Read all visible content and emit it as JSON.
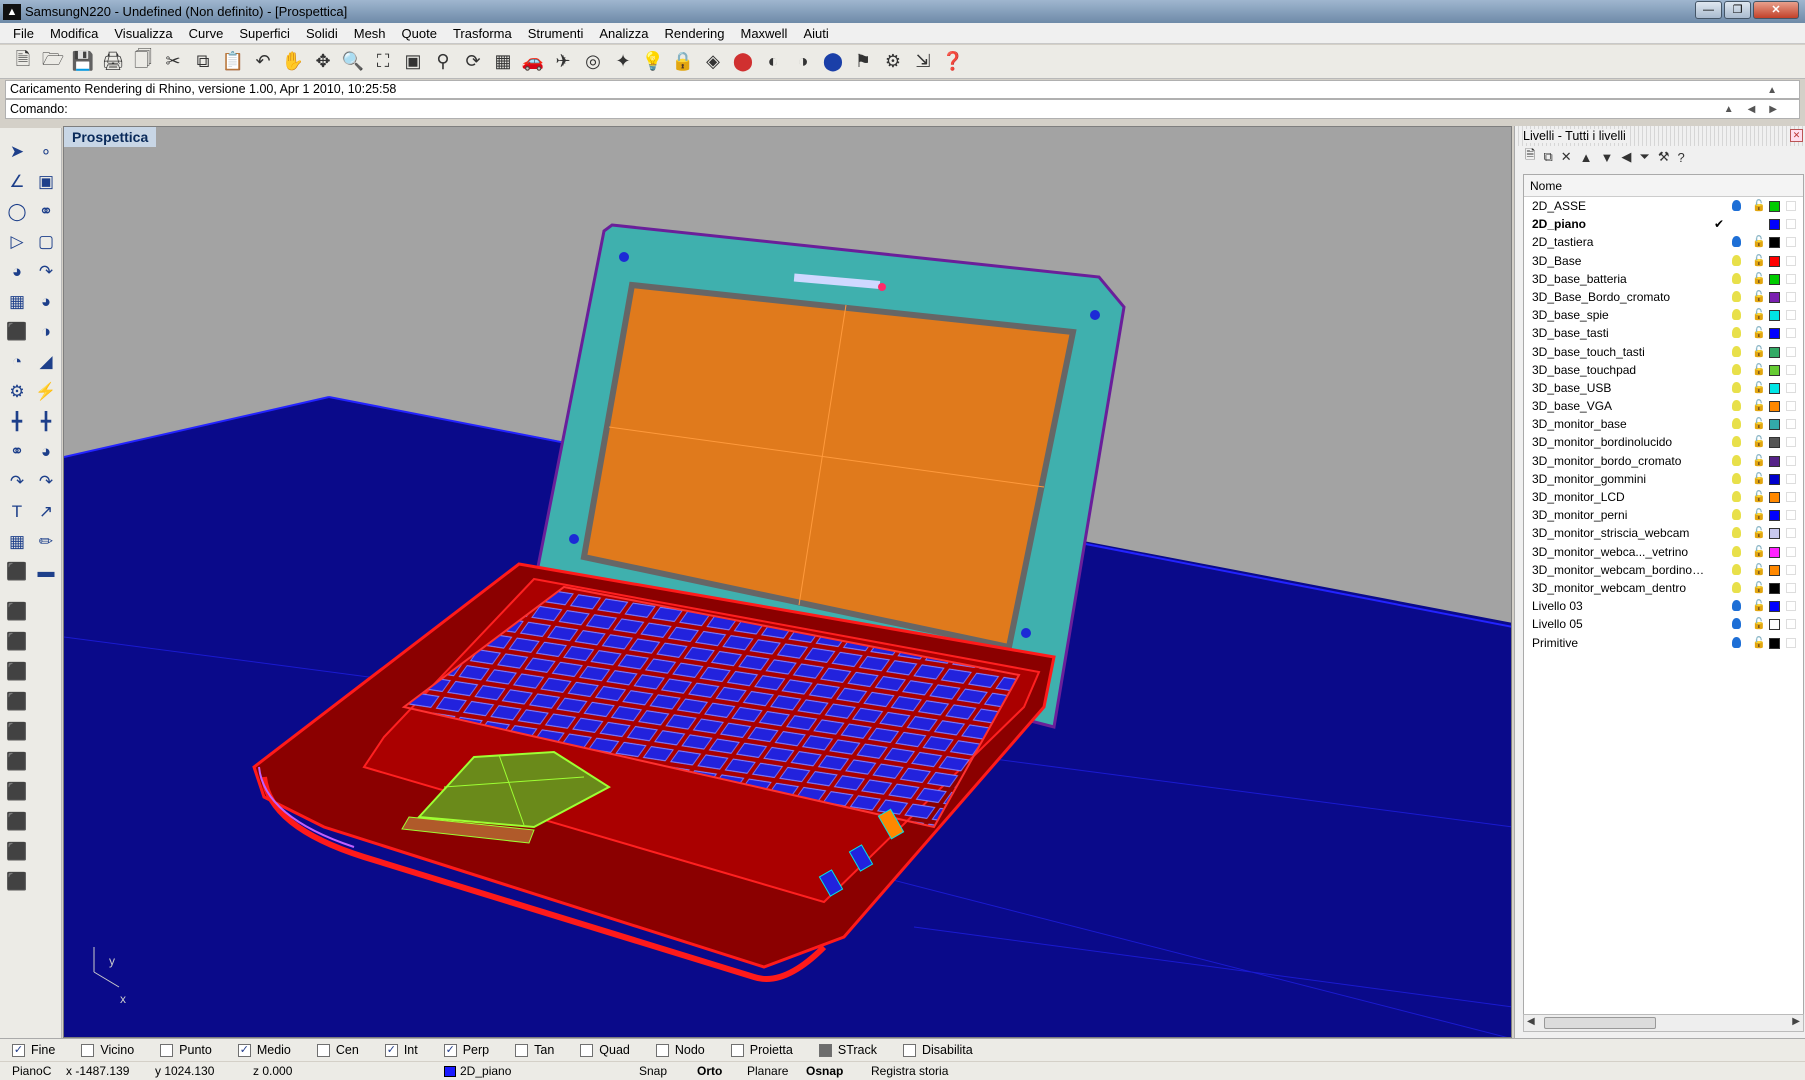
{
  "window": {
    "title": "SamsungN220 - Undefined (Non definito) - [Prospettica]",
    "app_icon": "rhino-icon",
    "controls": [
      "minimize",
      "maximize",
      "close"
    ]
  },
  "menu": [
    "File",
    "Modifica",
    "Visualizza",
    "Curve",
    "Superfici",
    "Solidi",
    "Mesh",
    "Quote",
    "Trasforma",
    "Strumenti",
    "Analizza",
    "Rendering",
    "Maxwell",
    "Aiuti"
  ],
  "toolbar_icons": [
    "new-icon",
    "open-icon",
    "save-icon",
    "print-icon",
    "import-icon",
    "cut-icon",
    "copy-icon",
    "paste-icon",
    "undo-icon",
    "pan-icon",
    "rotate-view-icon",
    "zoom-icon",
    "zoom-window-icon",
    "zoom-extents-icon",
    "zoom-selected-icon",
    "rotate-icon",
    "grid-icon",
    "car-icon",
    "plane-icon",
    "target-icon",
    "osnap-icon",
    "light-icon",
    "lock-icon",
    "render-icon",
    "color-wheel-icon",
    "shade-icon",
    "wire-icon",
    "render-sphere-icon",
    "flag-icon",
    "gear-icon",
    "dimension-icon",
    "help-icon"
  ],
  "command": {
    "history": "Caricamento Rendering di Rhino, versione 1.00, Apr  1 2010, 10:25:58",
    "prompt": "Comando:",
    "input": ""
  },
  "viewport": {
    "label": "Prospettica",
    "axis_x": "x",
    "axis_y": "y"
  },
  "layers_panel": {
    "title": "Livelli - Tutti i livelli",
    "column_header": "Nome",
    "tool_icons": [
      "new-layer-icon",
      "new-sublayer-icon",
      "delete-icon",
      "move-up-icon",
      "move-down-icon",
      "move-left-icon",
      "filter-icon",
      "tools-icon",
      "help-icon"
    ],
    "layers": [
      {
        "name": "2D_ASSE",
        "color": "#00cc00",
        "current": false,
        "bulb": "#1e6fd6"
      },
      {
        "name": "2D_piano",
        "color": "#0000ff",
        "current": true,
        "bulb": ""
      },
      {
        "name": "2D_tastiera",
        "color": "#000000",
        "current": false,
        "bulb": "#1e6fd6"
      },
      {
        "name": "3D_Base",
        "color": "#ff0000",
        "current": false,
        "bulb": "#e8e04a"
      },
      {
        "name": "3D_base_batteria",
        "color": "#00cc00",
        "current": false,
        "bulb": "#e8e04a"
      },
      {
        "name": "3D_Base_Bordo_cromato",
        "color": "#7a1fb0",
        "current": false,
        "bulb": "#e8e04a"
      },
      {
        "name": "3D_base_spie",
        "color": "#00e5e5",
        "current": false,
        "bulb": "#e8e04a"
      },
      {
        "name": "3D_base_tasti",
        "color": "#0000ff",
        "current": false,
        "bulb": "#e8e04a"
      },
      {
        "name": "3D_base_touch_tasti",
        "color": "#33aa66",
        "current": false,
        "bulb": "#e8e04a"
      },
      {
        "name": "3D_base_touchpad",
        "color": "#66cc33",
        "current": false,
        "bulb": "#e8e04a"
      },
      {
        "name": "3D_base_USB",
        "color": "#00e5e5",
        "current": false,
        "bulb": "#e8e04a"
      },
      {
        "name": "3D_base_VGA",
        "color": "#ff8800",
        "current": false,
        "bulb": "#e8e04a"
      },
      {
        "name": "3D_monitor_base",
        "color": "#33aaaa",
        "current": false,
        "bulb": "#e8e04a"
      },
      {
        "name": "3D_monitor_bordinolucido",
        "color": "#555555",
        "current": false,
        "bulb": "#e8e04a"
      },
      {
        "name": "3D_monitor_bordo_cromato",
        "color": "#552288",
        "current": false,
        "bulb": "#e8e04a"
      },
      {
        "name": "3D_monitor_gommini",
        "color": "#0000cc",
        "current": false,
        "bulb": "#e8e04a"
      },
      {
        "name": "3D_monitor_LCD",
        "color": "#ff8800",
        "current": false,
        "bulb": "#e8e04a"
      },
      {
        "name": "3D_monitor_perni",
        "color": "#0000ff",
        "current": false,
        "bulb": "#e8e04a"
      },
      {
        "name": "3D_monitor_striscia_webcam",
        "color": "#c8c8ee",
        "current": false,
        "bulb": "#e8e04a"
      },
      {
        "name": "3D_monitor_webca..._vetrino",
        "color": "#ff22ff",
        "current": false,
        "bulb": "#e8e04a"
      },
      {
        "name": "3D_monitor_webcam_bordinoro...",
        "color": "#ff8800",
        "current": false,
        "bulb": "#e8e04a"
      },
      {
        "name": "3D_monitor_webcam_dentro",
        "color": "#000000",
        "current": false,
        "bulb": "#e8e04a"
      },
      {
        "name": "Livello 03",
        "color": "#0000ff",
        "current": false,
        "bulb": "#1e6fd6"
      },
      {
        "name": "Livello 05",
        "color": "#ffffff",
        "current": false,
        "bulb": "#1e6fd6"
      },
      {
        "name": "Primitive",
        "color": "#000000",
        "current": false,
        "bulb": "#1e6fd6"
      }
    ]
  },
  "osnap": [
    {
      "label": "Fine",
      "checked": true
    },
    {
      "label": "Vicino",
      "checked": false
    },
    {
      "label": "Punto",
      "checked": false
    },
    {
      "label": "Medio",
      "checked": true
    },
    {
      "label": "Cen",
      "checked": false
    },
    {
      "label": "Int",
      "checked": true
    },
    {
      "label": "Perp",
      "checked": true
    },
    {
      "label": "Tan",
      "checked": false
    },
    {
      "label": "Quad",
      "checked": false
    },
    {
      "label": "Nodo",
      "checked": false
    },
    {
      "label": "Proietta",
      "checked": false
    },
    {
      "label": "STrack",
      "checked": false,
      "dark": true
    },
    {
      "label": "Disabilita",
      "checked": false
    }
  ],
  "status": {
    "cplane": "PianoC",
    "x": "x -1487.139",
    "y": "y 1024.130",
    "z": "z 0.000",
    "layer_color": "#1a1aff",
    "layer": "2D_piano",
    "snap": "Snap",
    "orto": "Orto",
    "planare": "Planare",
    "osnap": "Osnap",
    "history": "Registra storia"
  }
}
